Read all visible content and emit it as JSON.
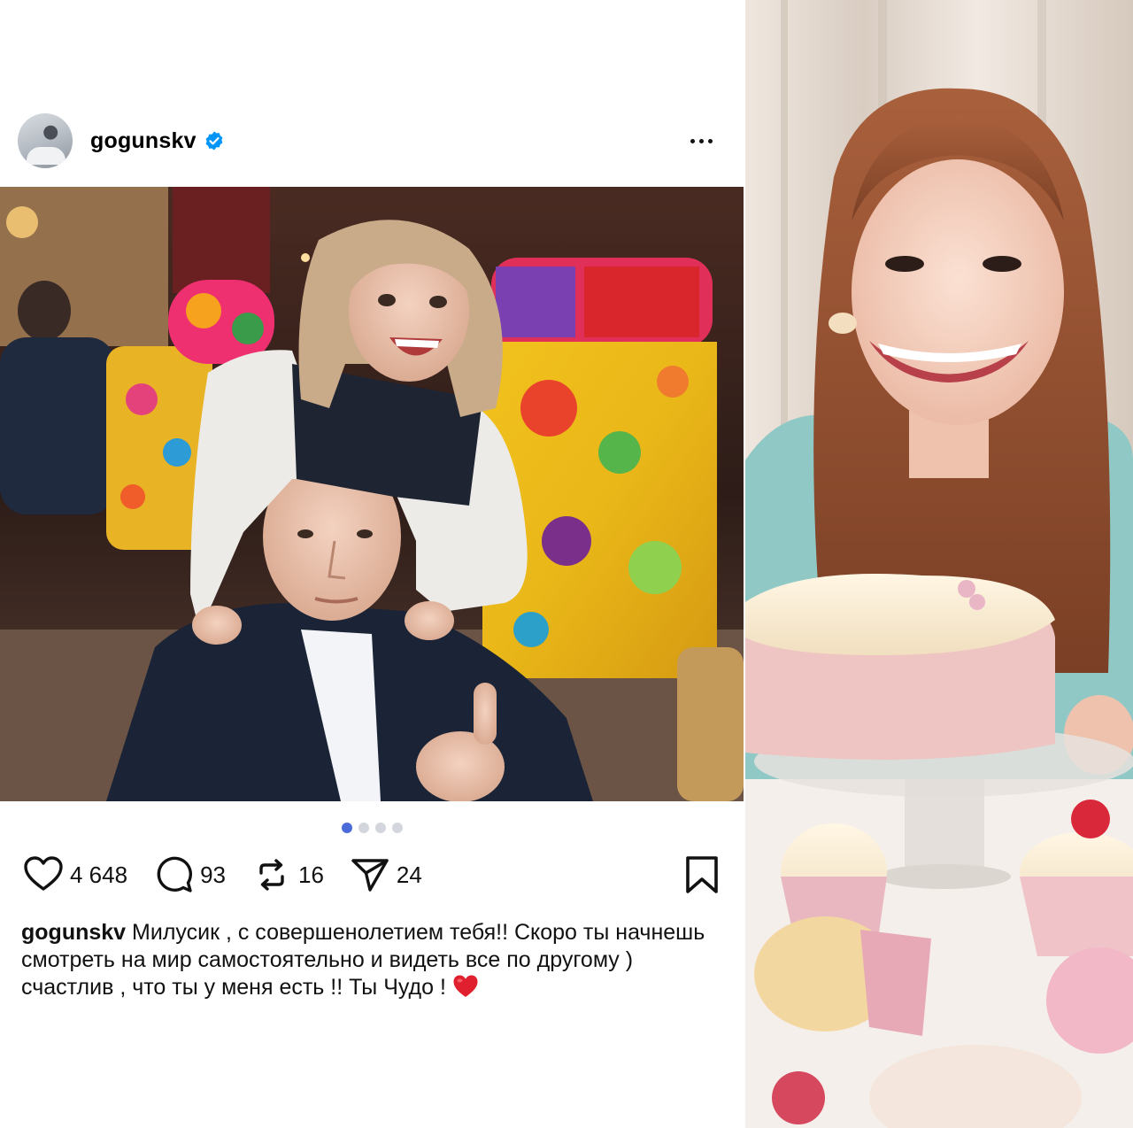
{
  "post": {
    "username": "gogunskv",
    "verified": true,
    "carousel": {
      "total": 4,
      "active": 1
    },
    "actions": {
      "likes": "4 648",
      "comments": "93",
      "reposts": "16",
      "shares": "24"
    },
    "caption": {
      "username": "gogunskv",
      "text": " Милусик , с совершенолетием тебя!! Скоро ты начнешь смотреть на мир самостоятельно и видеть все по другому ) счастлив , что ты у меня есть !! Ты Чудо ! "
    }
  },
  "colors": {
    "verified_blue": "#0095f6",
    "carousel_active": "#4a6bd9",
    "heart_emoji": "#e0202e"
  }
}
